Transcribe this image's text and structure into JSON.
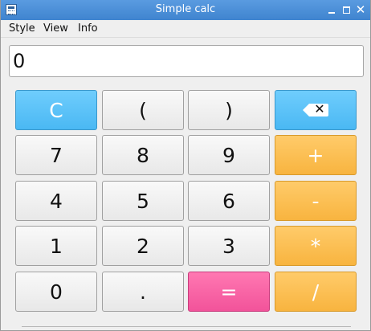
{
  "window": {
    "title": "Simple calc",
    "controls": {
      "minimize": "minimize",
      "maximize": "maximize",
      "close": "✕"
    }
  },
  "menu": {
    "items": [
      "Style",
      "View",
      "Info"
    ]
  },
  "display": {
    "value": "0"
  },
  "keys": {
    "clear": "C",
    "open_paren": "(",
    "close_paren": ")",
    "backspace_icon": "backspace-icon",
    "seven": "7",
    "eight": "8",
    "nine": "9",
    "plus": "+",
    "four": "4",
    "five": "5",
    "six": "6",
    "minus": "-",
    "one": "1",
    "two": "2",
    "three": "3",
    "multiply": "*",
    "zero": "0",
    "dot": ".",
    "equals": "=",
    "divide": "/"
  },
  "colors": {
    "titlebar": "#4a8ed6",
    "clear_key": "#58c0f7",
    "operator_key": "#fbbd4f",
    "equals_key": "#f760a5",
    "number_key": "#f2f2f2"
  }
}
